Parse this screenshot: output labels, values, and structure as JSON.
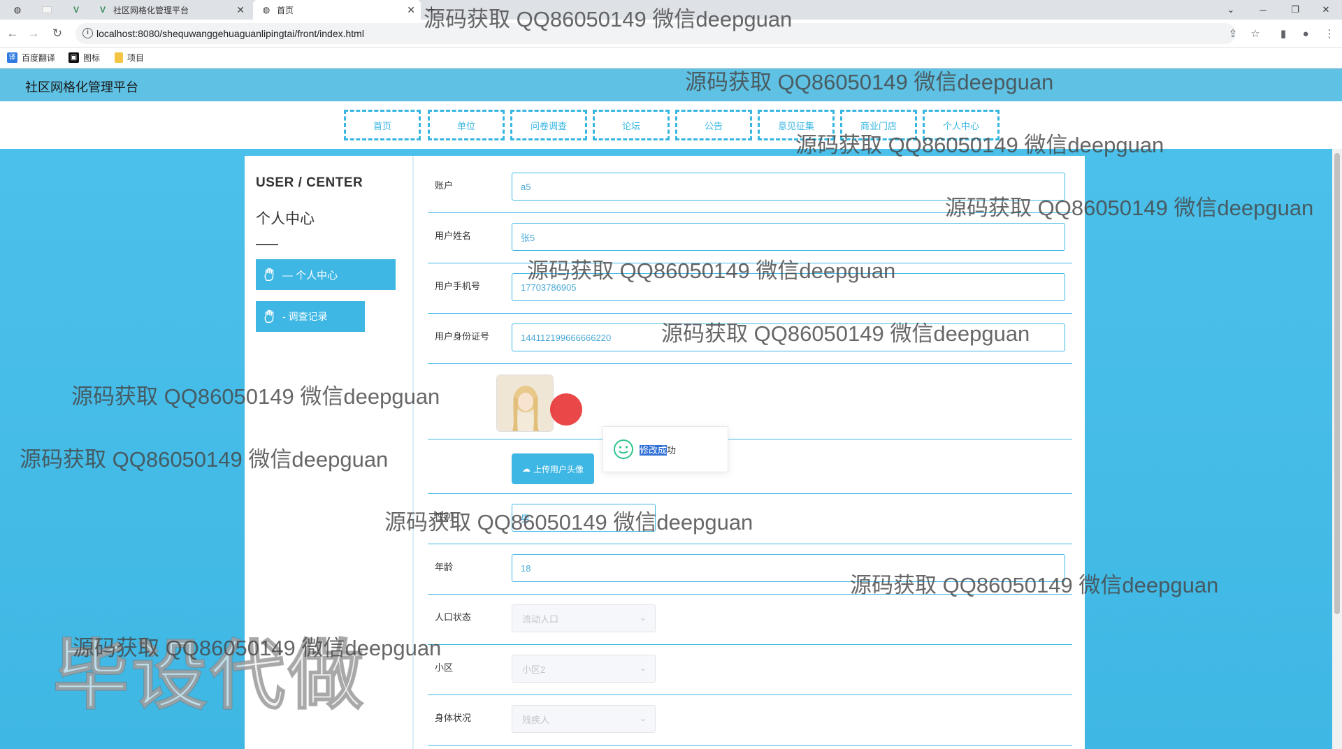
{
  "browser": {
    "tabs": [
      {
        "label": ""
      },
      {
        "label": ""
      },
      {
        "label": ""
      },
      {
        "label": "社区网格化管理平台"
      },
      {
        "label": "首页"
      }
    ],
    "url": "localhost:8080/shequwanggehuaguanlipingtai/front/index.html",
    "bookmarks": [
      "百度翻译",
      "图标",
      "项目"
    ]
  },
  "site": {
    "title": "社区网格化管理平台",
    "nav": [
      "首页",
      "单位",
      "问卷调查",
      "论坛",
      "公告",
      "意见征集",
      "商业门店",
      "个人中心"
    ]
  },
  "sidebar": {
    "title_en": "USER / CENTER",
    "title_cn": "个人中心",
    "items": [
      {
        "label": "— 个人中心"
      },
      {
        "label": "- 调查记录"
      }
    ]
  },
  "form": {
    "account": {
      "label": "账户",
      "value": "a5"
    },
    "name": {
      "label": "用户姓名",
      "value": "张5"
    },
    "phone": {
      "label": "用户手机号",
      "value": "17703786905"
    },
    "idcard": {
      "label": "用户身份证号",
      "value": "144112199666666220"
    },
    "upload_label": "上传用户头像",
    "gender": {
      "label": "性别",
      "value": "男"
    },
    "age": {
      "label": "年龄",
      "value": "18"
    },
    "population": {
      "label": "人口状态",
      "value": "流动人口"
    },
    "community": {
      "label": "小区",
      "value": "小区2"
    },
    "health": {
      "label": "身体状况",
      "value": "残疾人"
    }
  },
  "toast": {
    "selected": "修改成",
    "rest": "功"
  },
  "watermarks": {
    "text": "源码获取 QQ86050149 微信deepguan",
    "big": "毕设代做"
  },
  "colors": {
    "accent": "#3eb7e4",
    "header": "#5fc1e3",
    "background": "#4bc0ea"
  }
}
